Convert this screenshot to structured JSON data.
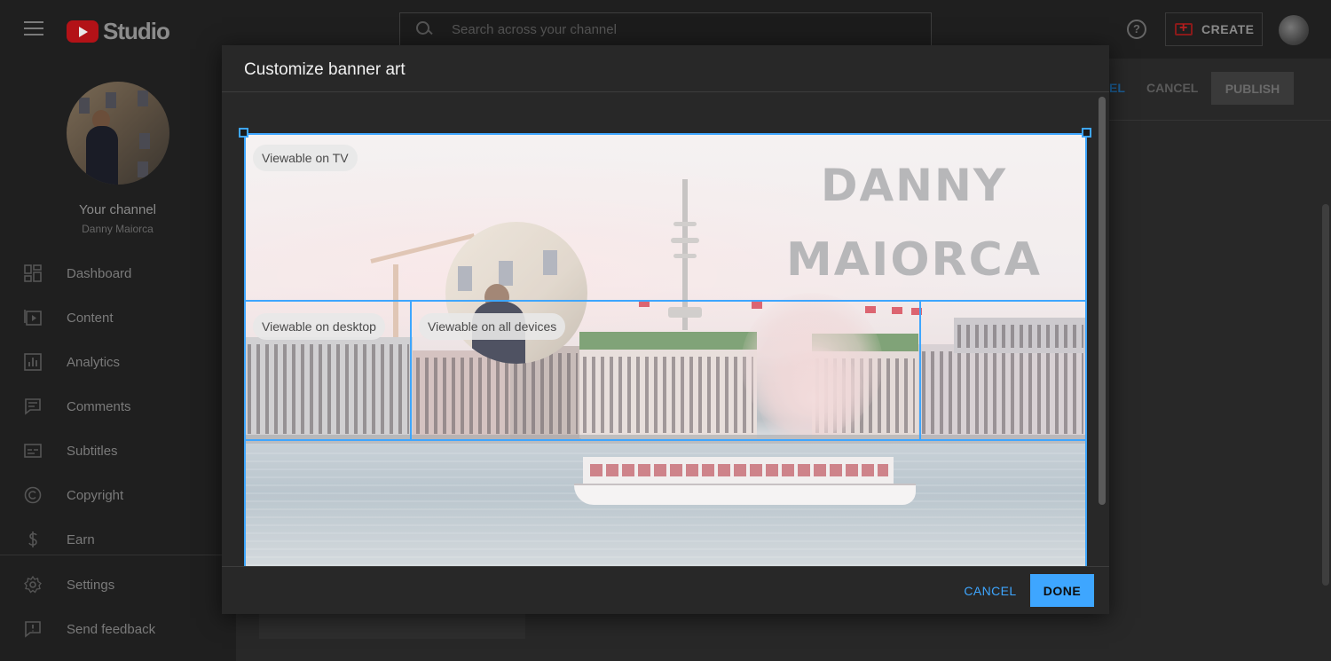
{
  "topbar": {
    "logo_text": "Studio",
    "search_placeholder": "Search across your channel",
    "help_glyph": "?",
    "create_label": "CREATE"
  },
  "sidebar": {
    "your_channel": "Your channel",
    "channel_name": "Danny Maiorca",
    "items": [
      {
        "label": "Dashboard",
        "icon": "dashboard-icon"
      },
      {
        "label": "Content",
        "icon": "content-icon"
      },
      {
        "label": "Analytics",
        "icon": "analytics-icon"
      },
      {
        "label": "Comments",
        "icon": "comments-icon"
      },
      {
        "label": "Subtitles",
        "icon": "subtitles-icon"
      },
      {
        "label": "Copyright",
        "icon": "copyright-icon"
      },
      {
        "label": "Earn",
        "icon": "earn-icon"
      },
      {
        "label": "Settings",
        "icon": "settings-icon"
      },
      {
        "label": "Send feedback",
        "icon": "feedback-icon"
      }
    ]
  },
  "background_header": {
    "partial_link": "EL",
    "cancel_label": "CANCEL",
    "publish_label": "PUBLISH"
  },
  "modal": {
    "title": "Customize banner art",
    "cancel_label": "CANCEL",
    "done_label": "DONE",
    "labels": {
      "tv": "Viewable on TV",
      "desktop": "Viewable on desktop",
      "all_devices": "Viewable on all devices"
    },
    "banner_text": {
      "line1": "DANNY",
      "line2": "MAIORCA"
    }
  },
  "colors": {
    "accent": "#3ea6ff",
    "youtube_red": "#b31217"
  }
}
